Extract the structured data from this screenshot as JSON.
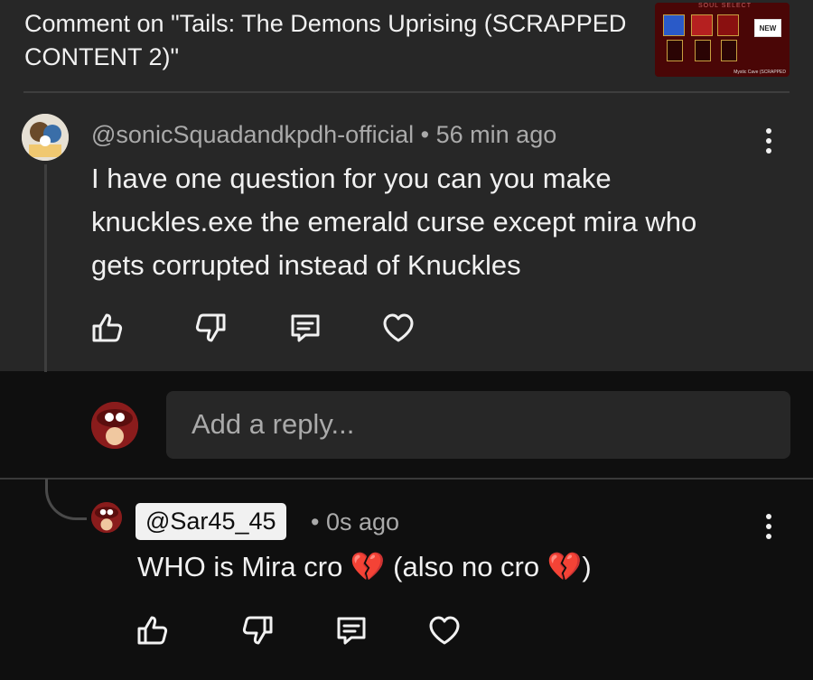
{
  "header": {
    "title": "Comment on \"Tails: The Demons Uprising (SCRAPPED CONTENT 2)\"",
    "thumbnail": {
      "top_text": "SOUL SELECT",
      "badge": "NEW",
      "caption": "Mystic Cave (SCRAPPED"
    }
  },
  "comment": {
    "author": "@sonicSquadandkpdh-official",
    "separator": "•",
    "time": "56 min ago",
    "text": "I have one question for you can you make knuckles.exe the emerald curse except mira who gets corrupted instead of Knuckles"
  },
  "reply_box": {
    "placeholder": "Add a reply..."
  },
  "reply": {
    "author": "@Sar45_45",
    "separator": "•",
    "time": "0s ago",
    "text": "WHO is Mira cro 💔 (also no cro 💔)"
  },
  "icons": {
    "like": "thumbs-up-icon",
    "dislike": "thumbs-down-icon",
    "reply": "comment-icon",
    "heart": "heart-icon",
    "more": "more-vertical-icon"
  },
  "colors": {
    "page_bg": "#0f0f0f",
    "card_bg": "#272727",
    "text": "#f1f1f1",
    "secondary_text": "#aaaaaa"
  }
}
